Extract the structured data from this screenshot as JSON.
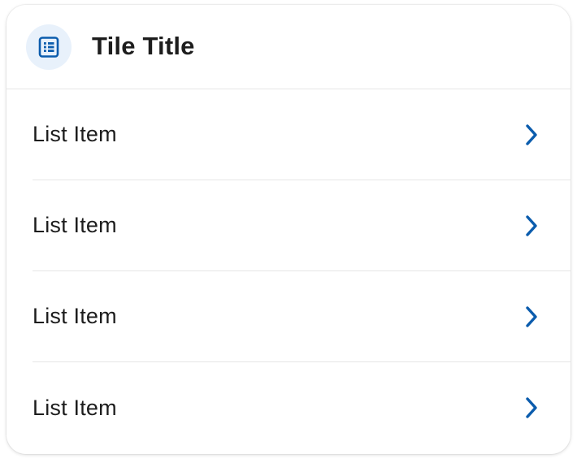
{
  "tile": {
    "title": "Tile Title",
    "header_icon": "list-document-icon",
    "item_icon": "chevron-right-icon",
    "accent_color": "#0b5cad",
    "icon_bg_color": "#e8f1fb",
    "items": [
      {
        "label": "List Item"
      },
      {
        "label": "List Item"
      },
      {
        "label": "List Item"
      },
      {
        "label": "List Item"
      }
    ]
  }
}
